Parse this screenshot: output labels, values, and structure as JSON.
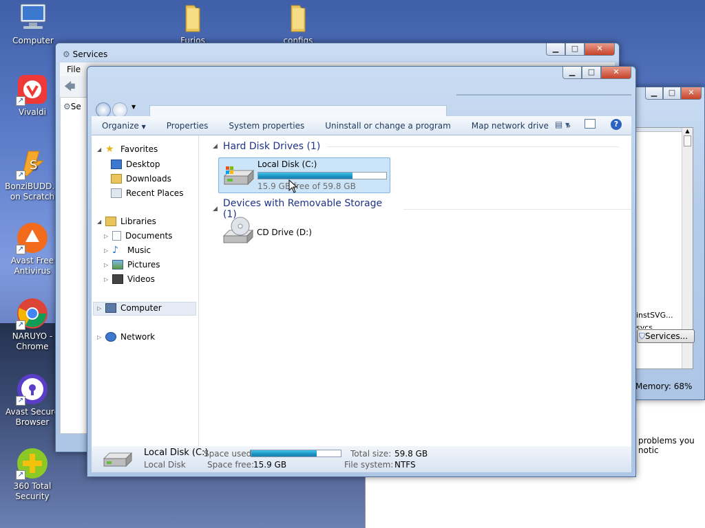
{
  "desktop": {
    "icons": [
      {
        "label": "Computer",
        "icon": "computer-icon"
      },
      {
        "label": "Furios",
        "icon": "folder-icon"
      },
      {
        "label": "configs",
        "icon": "folder-icon"
      },
      {
        "label": "Vivaldi",
        "icon": "vivaldi-icon"
      },
      {
        "label": "BonziBUDD... on Scratch",
        "icon": "scratch-icon"
      },
      {
        "label": "Avast Free Antivirus",
        "icon": "avast-icon"
      },
      {
        "label": "NARUYO - Chrome",
        "icon": "chrome-icon"
      },
      {
        "label": "Avast Secure Browser",
        "icon": "avast-browser-icon"
      },
      {
        "label": "360 Total Security",
        "icon": "360-icon"
      }
    ]
  },
  "services_window": {
    "title": "Services",
    "menu_file": "File",
    "tree_item": "Se"
  },
  "task_manager": {
    "row_label": "instSVG...",
    "row_label2": "svcs",
    "services_button": "Services...",
    "memory": "Memory: 68%"
  },
  "bg_window": {
    "text": "problems you notic"
  },
  "explorer": {
    "toolbar": {
      "organize": "Organize",
      "properties": "Properties",
      "system_properties": "System properties",
      "uninstall": "Uninstall or change a program",
      "map_drive": "Map network drive",
      "more": "»"
    },
    "nav": {
      "favorites": "Favorites",
      "desktop": "Desktop",
      "downloads": "Downloads",
      "recent": "Recent Places",
      "libraries": "Libraries",
      "documents": "Documents",
      "music": "Music",
      "pictures": "Pictures",
      "videos": "Videos",
      "computer": "Computer",
      "network": "Network"
    },
    "groups": {
      "hdd": "Hard Disk Drives (1)",
      "removable": "Devices with Removable Storage (1)"
    },
    "drive_c": {
      "name": "Local Disk (C:)",
      "space": "15.9 GB free of 59.8 GB",
      "used_fraction": 0.734
    },
    "drive_d": {
      "name": "CD Drive (D:)"
    },
    "status": {
      "name": "Local Disk (C:)",
      "type": "Local Disk",
      "used_label": "Space used:",
      "free_label": "Space free:",
      "free_value": "15.9 GB",
      "total_label": "Total size:",
      "total_value": "59.8 GB",
      "fs_label": "File system:",
      "fs_value": "NTFS"
    }
  },
  "colors": {
    "accent": "#1e3287",
    "bar": "#1a93c2",
    "selection": "#cce4f7"
  }
}
